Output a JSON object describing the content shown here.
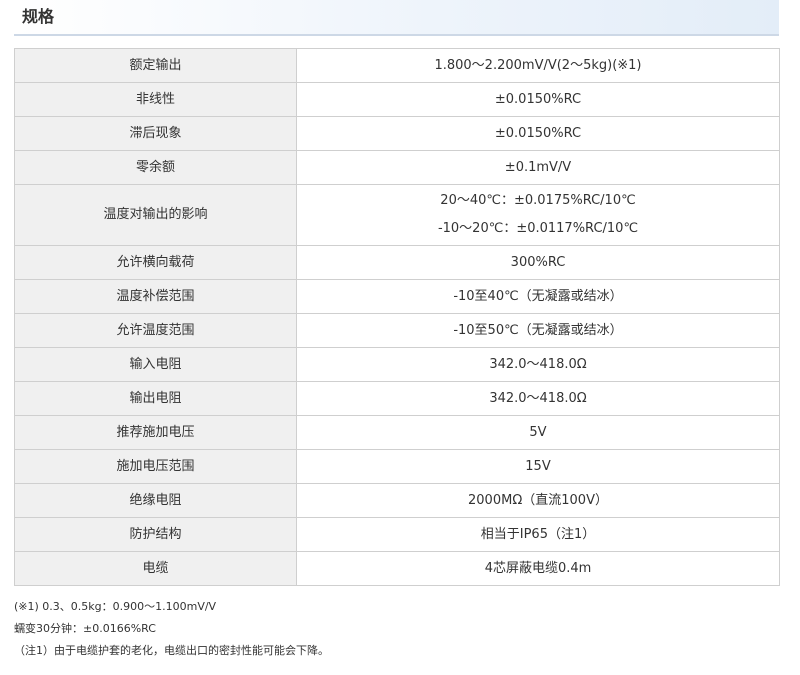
{
  "section": {
    "title": "规格"
  },
  "specs": [
    {
      "label": "额定输出",
      "value": "1.800～2.200mV/V(2～5kg)(※1)"
    },
    {
      "label": "非线性",
      "value": "±0.0150%RC"
    },
    {
      "label": "滞后现象",
      "value": "±0.0150%RC"
    },
    {
      "label": "零余额",
      "value": "±0.1mV/V"
    },
    {
      "label": "温度对输出的影响",
      "value": "20～40℃：±0.0175%RC/10℃",
      "value2": "-10～20℃：±0.0117%RC/10℃"
    },
    {
      "label": "允许横向载荷",
      "value": "300%RC"
    },
    {
      "label": "温度补偿范围",
      "value": "-10至40℃（无凝露或结冰）"
    },
    {
      "label": "允许温度范围",
      "value": "-10至50℃（无凝露或结冰）"
    },
    {
      "label": "输入电阻",
      "value": "342.0～418.0Ω"
    },
    {
      "label": "输出电阻",
      "value": "342.0～418.0Ω"
    },
    {
      "label": "推荐施加电压",
      "value": "5V"
    },
    {
      "label": "施加电压范围",
      "value": "15V"
    },
    {
      "label": "绝缘电阻",
      "value": "2000MΩ（直流100V）"
    },
    {
      "label": "防护结构",
      "value": "相当于IP65（注1）"
    },
    {
      "label": "电缆",
      "value": "4芯屏蔽电缆0.4m"
    }
  ],
  "notes": [
    "(※1) 0.3、0.5kg：0.900～1.100mV/V",
    "蠕变30分钟：±0.0166%RC",
    "（注1）由于电缆护套的老化，电缆出口的密封性能可能会下降。"
  ]
}
